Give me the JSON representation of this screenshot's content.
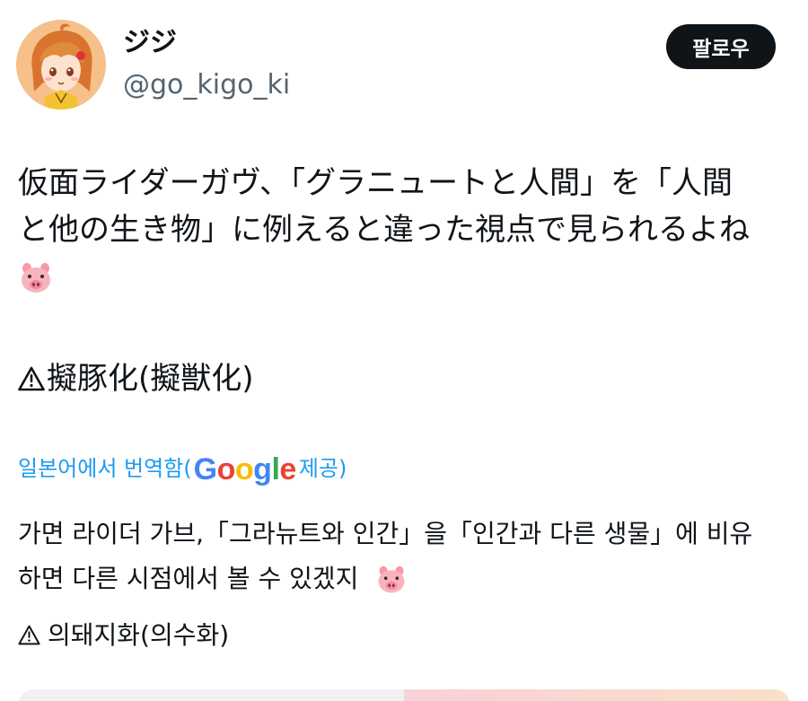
{
  "user": {
    "display_name": "ジジ",
    "handle": "@go_kigo_ki",
    "avatar_icon": "anime-girl-avatar"
  },
  "follow_button": {
    "label": "팔로우"
  },
  "tweet": {
    "line1": "仮面ライダーガヴ、「グラニュートと人間」を「人間",
    "line2": "と他の生き物」に例えると違った視点で見られるよね",
    "emoji": "pig-face-emoji",
    "warning_text": "擬豚化(擬獣化)",
    "warning_icon": "warning-icon"
  },
  "translation": {
    "label": "일본어에서 번역함(",
    "provider": "Google",
    "provider_suffix": " 제공)",
    "line1": "가면 라이더 가브,「그라뉴트와 인간」을「인간과 다른 생물」에 비유",
    "line2": "하면 다른 시점에서 볼 수 있겠지",
    "warning_text": "의돼지화(의수화)"
  },
  "colors": {
    "text": "#0f1419",
    "secondary": "#536471",
    "link": "#1d9bf0",
    "button_bg": "#0f1419",
    "button_text": "#ffffff"
  }
}
